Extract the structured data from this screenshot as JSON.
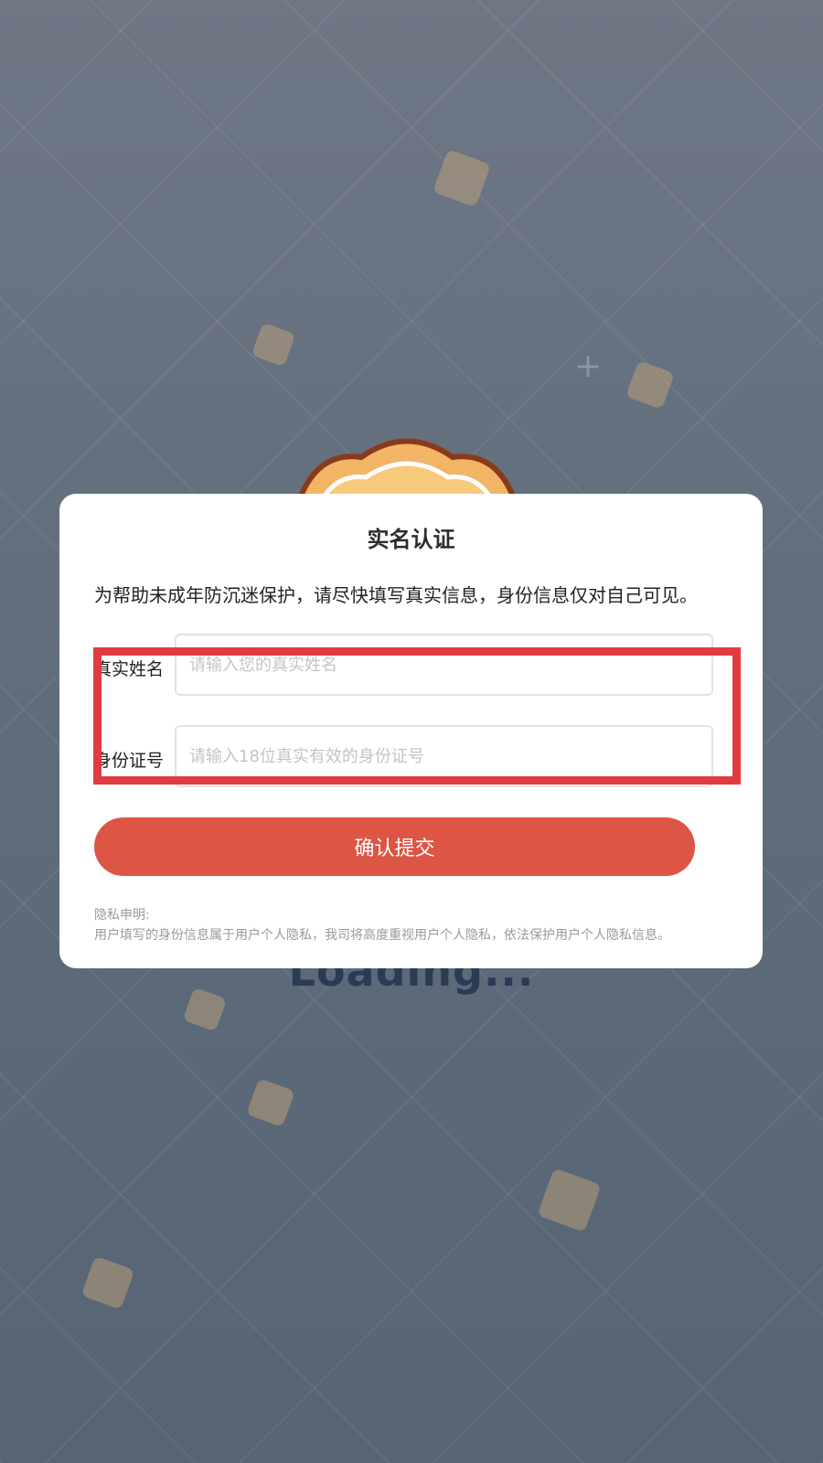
{
  "background": {
    "loading_text": "Loading..."
  },
  "dialog": {
    "title": "实名认证",
    "intro": "为帮助未成年防沉迷保护，请尽快填写真实信息，身份信息仅对自己可见。",
    "name_field": {
      "label": "真实姓名",
      "value": "",
      "placeholder": "请输入您的真实姓名"
    },
    "id_field": {
      "label": "身份证号",
      "value": "",
      "placeholder": "请输入18位真实有效的身份证号"
    },
    "submit_label": "确认提交",
    "privacy_title": "隐私申明:",
    "privacy_text": "用户填写的身份信息属于用户个人隐私，我司将高度重视用户个人隐私，依法保护用户个人隐私信息。"
  },
  "colors": {
    "accent": "#dd5544",
    "highlight": "#e03b41"
  }
}
